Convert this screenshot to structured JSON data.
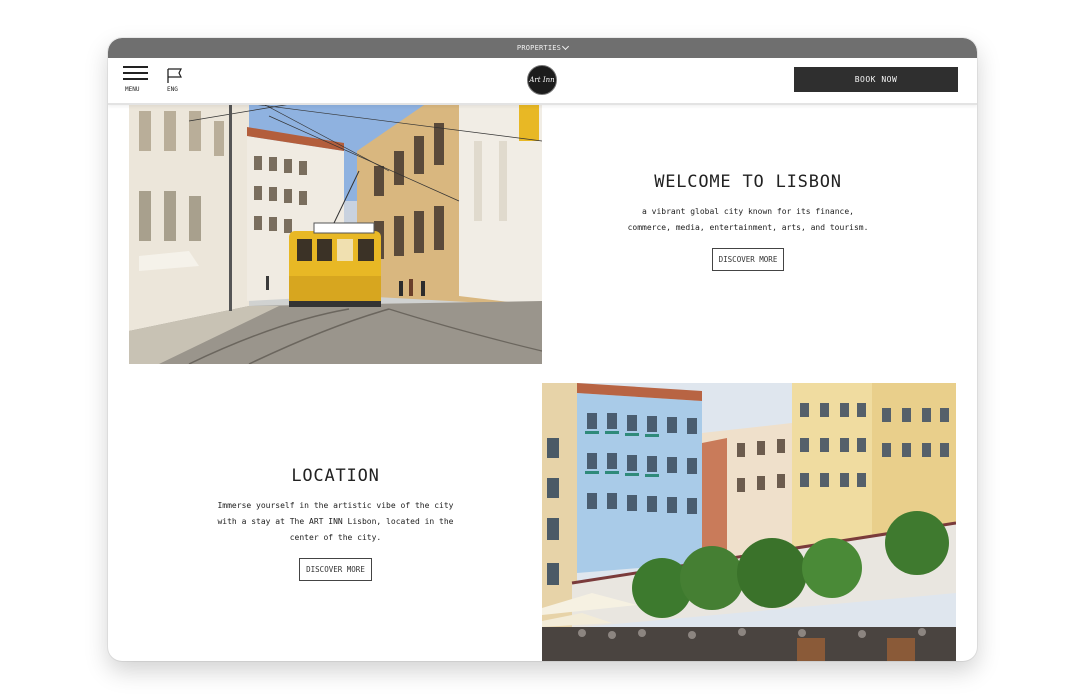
{
  "top_bar": {
    "properties_label": "PROPERTIES"
  },
  "header": {
    "menu_label": "MENU",
    "language_label": "ENG",
    "logo_text": "Art Inn",
    "book_now_label": "BOOK NOW"
  },
  "welcome": {
    "title": "WELCOME TO LISBON",
    "line1": "a vibrant global city known for its finance,",
    "line2": "commerce, media, entertainment, arts, and tourism.",
    "button_label": "DISCOVER MORE"
  },
  "location": {
    "title": "LOCATION",
    "line1": "Immerse yourself in the artistic vibe of the city",
    "line2": "with a stay at The ART INN Lisbon, located in the",
    "line3": "center of the city.",
    "button_label": "DISCOVER MORE"
  },
  "colors": {
    "top_bar": "#6f6f6f",
    "book_button": "#2f2f2f",
    "tram_yellow": "#e8b825"
  },
  "icons": [
    "hamburger-menu-icon",
    "flag-icon",
    "chevron-down-icon"
  ]
}
